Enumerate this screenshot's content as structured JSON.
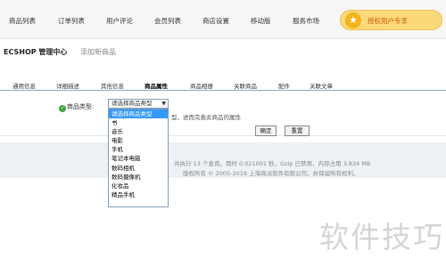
{
  "top_nav": {
    "items": [
      "商品列表",
      "订单列表",
      "用户评论",
      "会员列表",
      "商店设置",
      "移动版",
      "服务市场"
    ],
    "promo_label": "授权用户专享",
    "promo_color": "#fbd97a"
  },
  "header": {
    "site_title": "ECSHOP 管理中心",
    "page_title": "添加新商品"
  },
  "tabs": [
    "通用信息",
    "详细描述",
    "其他信息",
    "商品属性",
    "商品相册",
    "关联商品",
    "配件",
    "关联文章"
  ],
  "active_tab": "商品属性",
  "form": {
    "field_label": "商品类型:",
    "select_value": "请选择商品类型",
    "options": [
      "请选择商品类型",
      "书",
      "音乐",
      "电影",
      "手机",
      "笔记本电脑",
      "数码相机",
      "数码摄像机",
      "化妆品",
      "精品手机"
    ],
    "hint": "型，进而完善此商品的属性",
    "ok_label": "确定",
    "reset_label": "重置"
  },
  "footer": {
    "stats": "共执行 13 个查询，用时 0.021001 秒，Gzip 已禁用，内存占用 3.834 MB",
    "copyright": "版权所有 © 2005-2018 上海商派软件有限公司，并保留所有权利。"
  },
  "watermark": "软件技巧"
}
